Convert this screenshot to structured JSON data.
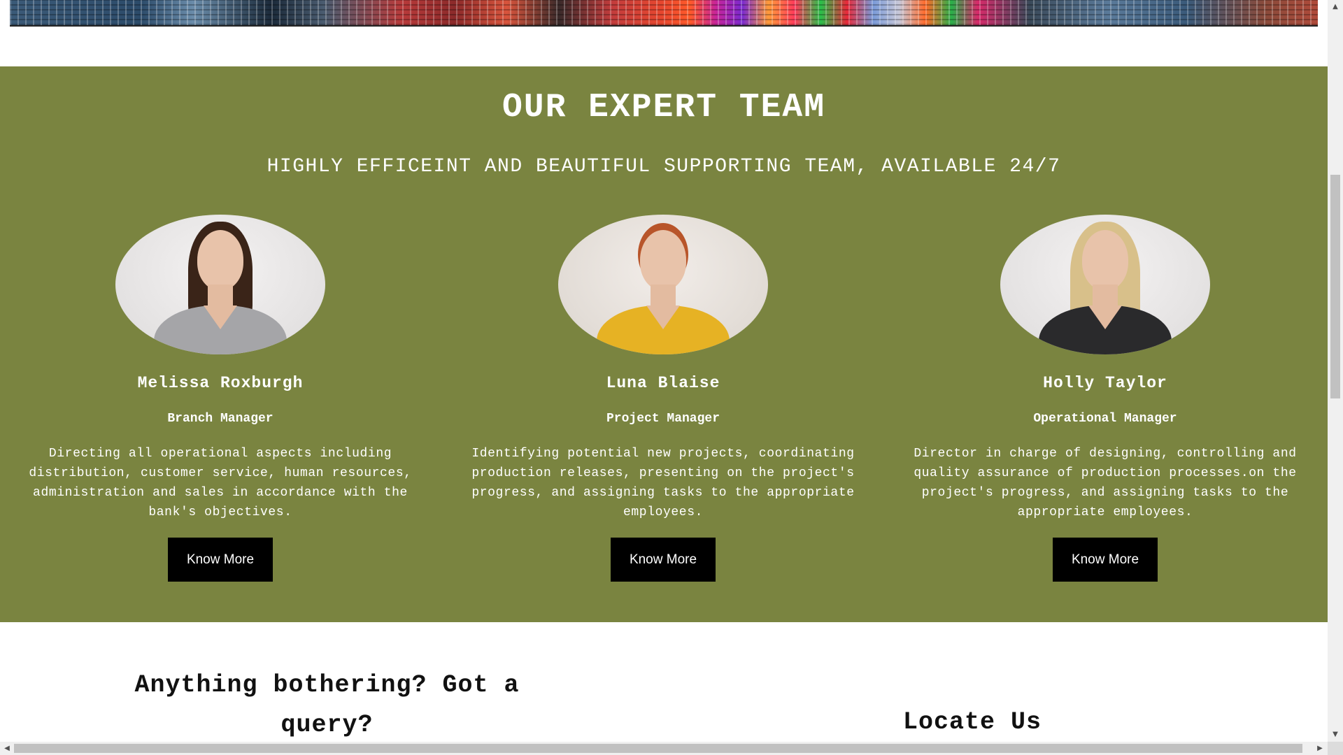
{
  "team": {
    "title": "OUR EXPERT TEAM",
    "subtitle": "HIGHLY EFFICEINT AND BEAUTIFUL SUPPORTING TEAM, AVAILABLE 24/7",
    "background_color": "#7a8440",
    "members": [
      {
        "name": "Melissa Roxburgh",
        "role": "Branch Manager",
        "description": "Directing all operational aspects including distribution, customer service, human resources, administration and sales in accordance with the bank's objectives.",
        "button_label": "Know More"
      },
      {
        "name": "Luna Blaise",
        "role": "Project Manager",
        "description": "Identifying potential new projects, coordinating production releases, presenting on the project's progress, and assigning tasks to the appropriate employees.",
        "button_label": "Know More"
      },
      {
        "name": "Holly Taylor",
        "role": "Operational Manager",
        "description": "Director in charge of designing, controlling and quality assurance of production processes.on the project's progress, and assigning tasks to the appropriate employees.",
        "button_label": "Know More"
      }
    ]
  },
  "contact": {
    "query_heading": "Anything bothering? Got a query?",
    "locate_heading": "Locate Us"
  },
  "scrollbars": {
    "up_arrow": "▲",
    "down_arrow": "▼",
    "left_arrow": "◀",
    "right_arrow": "▶"
  }
}
